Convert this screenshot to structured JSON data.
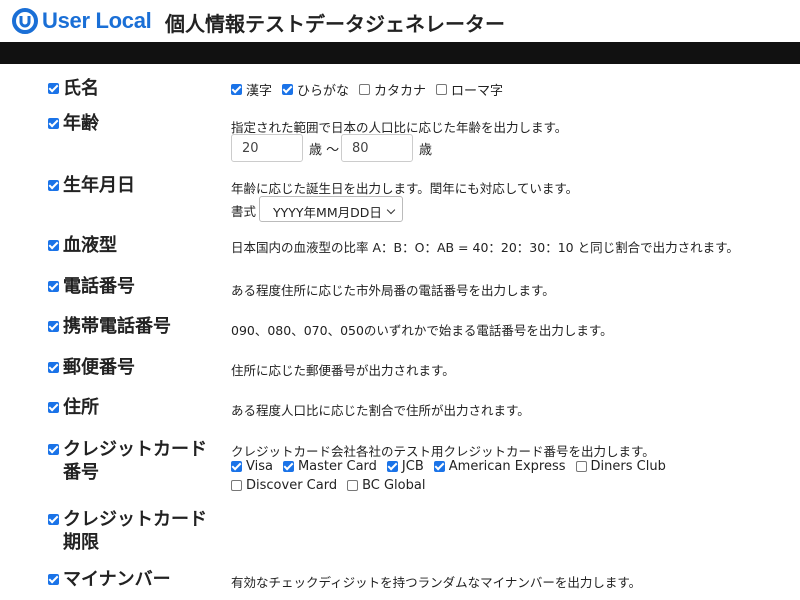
{
  "header": {
    "brand": "User Local",
    "title": "個人情報テストデータジェネレーター"
  },
  "fields": [
    {
      "label": "氏名",
      "checked": true
    },
    {
      "label": "年齢",
      "checked": true
    },
    {
      "label": "生年月日",
      "checked": true
    },
    {
      "label": "血液型",
      "checked": true
    },
    {
      "label": "電話番号",
      "checked": true
    },
    {
      "label": "携帯電話番号",
      "checked": true
    },
    {
      "label": "郵便番号",
      "checked": true
    },
    {
      "label": "住所",
      "checked": true
    },
    {
      "label": "クレジットカード番号",
      "checked": true
    },
    {
      "label": "クレジットカード期限",
      "checked": true
    },
    {
      "label": "マイナンバー",
      "checked": true
    }
  ],
  "name_options": [
    {
      "label": "漢字",
      "checked": true
    },
    {
      "label": "ひらがな",
      "checked": true
    },
    {
      "label": "カタカナ",
      "checked": false
    },
    {
      "label": "ローマ字",
      "checked": false
    }
  ],
  "age": {
    "desc": "指定された範囲で日本の人口比に応じた年齢を出力します。",
    "min": "20",
    "unit_min": "歳 〜",
    "max": "80",
    "unit_max": "歳"
  },
  "birthday": {
    "desc": "年齢に応じた誕生日を出力します。閏年にも対応しています。",
    "format_label": "書式",
    "format_value": "YYYY年MM月DD日"
  },
  "blood": {
    "desc": "日本国内の血液型の比率 A：B：O：AB = 40：20：30：10 と同じ割合で出力されます。"
  },
  "phone": {
    "desc": "ある程度住所に応じた市外局番の電話番号を出力します。"
  },
  "mobile": {
    "desc": "090、080、070、050のいずれかで始まる電話番号を出力します。"
  },
  "postal": {
    "desc": "住所に応じた郵便番号が出力されます。"
  },
  "address": {
    "desc": "ある程度人口比に応じた割合で住所が出力されます。"
  },
  "credit": {
    "desc": "クレジットカード会社各社のテスト用クレジットカード番号を出力します。",
    "brands_row1": [
      {
        "label": "Visa",
        "checked": true
      },
      {
        "label": "Master Card",
        "checked": true
      },
      {
        "label": "JCB",
        "checked": true
      },
      {
        "label": "American Express",
        "checked": true
      },
      {
        "label": "Diners Club",
        "checked": false
      }
    ],
    "brands_row2": [
      {
        "label": "Discover Card",
        "checked": false
      },
      {
        "label": "BC Global",
        "checked": false
      }
    ]
  },
  "mynumber": {
    "desc": "有効なチェックディジットを持つランダムなマイナンバーを出力します。"
  },
  "colors": {
    "brand": "#1a6fd6",
    "checkbox": "#1a73e8",
    "topbar": "#111111"
  }
}
